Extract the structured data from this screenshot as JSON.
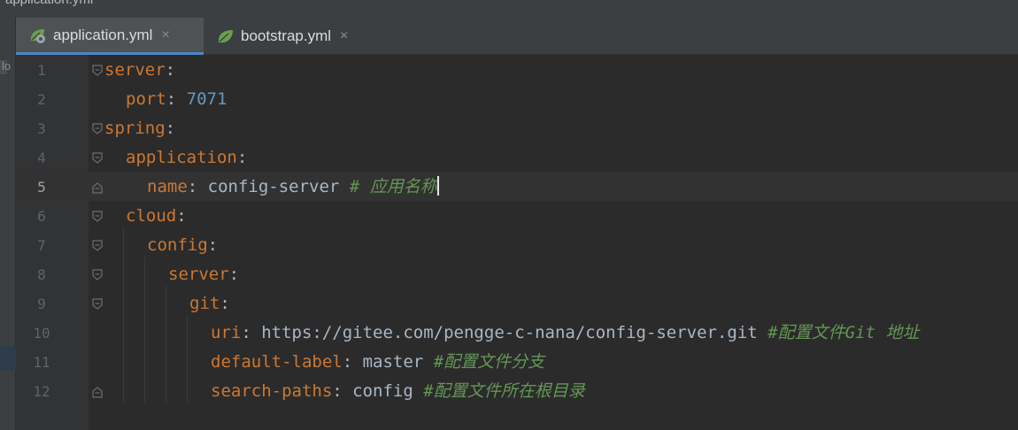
{
  "window": {
    "title": "application.yml"
  },
  "tabs": [
    {
      "label": "application.yml",
      "active": true,
      "close": "×",
      "icon": "spring-leaf-gear-icon"
    },
    {
      "label": "bootstrap.yml",
      "active": false,
      "close": "×",
      "icon": "spring-leaf-icon"
    }
  ],
  "left_strip": {
    "clipped_text": "lo"
  },
  "editor": {
    "current_line": 5,
    "lines": [
      {
        "n": "1",
        "key": "server",
        "sep": ":",
        "value": "",
        "comment": ""
      },
      {
        "n": "2",
        "key": "port",
        "sep": ": ",
        "value": "7071",
        "comment": ""
      },
      {
        "n": "3",
        "key": "spring",
        "sep": ":",
        "value": "",
        "comment": ""
      },
      {
        "n": "4",
        "key": "application",
        "sep": ":",
        "value": "",
        "comment": ""
      },
      {
        "n": "5",
        "key": "name",
        "sep": ": ",
        "value": "config-server ",
        "comment": "# 应用名称"
      },
      {
        "n": "6",
        "key": "cloud",
        "sep": ":",
        "value": "",
        "comment": ""
      },
      {
        "n": "7",
        "key": "config",
        "sep": ":",
        "value": "",
        "comment": ""
      },
      {
        "n": "8",
        "key": "server",
        "sep": ":",
        "value": "",
        "comment": ""
      },
      {
        "n": "9",
        "key": "git",
        "sep": ":",
        "value": "",
        "comment": ""
      },
      {
        "n": "10",
        "key": "uri",
        "sep": ": ",
        "value": "https://gitee.com/pengge-c-nana/config-server.git ",
        "comment": "#配置文件Git 地址"
      },
      {
        "n": "11",
        "key": "default-label",
        "sep": ": ",
        "value": "master ",
        "comment": "#配置文件分支"
      },
      {
        "n": "12",
        "key": "search-paths",
        "sep": ": ",
        "value": "config ",
        "comment": "#配置文件所在根目录"
      }
    ]
  },
  "colors": {
    "background": "#2b2b2b",
    "gutter": "#313335",
    "key": "#cc7832",
    "number": "#6897bb",
    "text": "#a9b7c6",
    "comment": "#629755",
    "active_tab_underline": "#4a88c7"
  }
}
